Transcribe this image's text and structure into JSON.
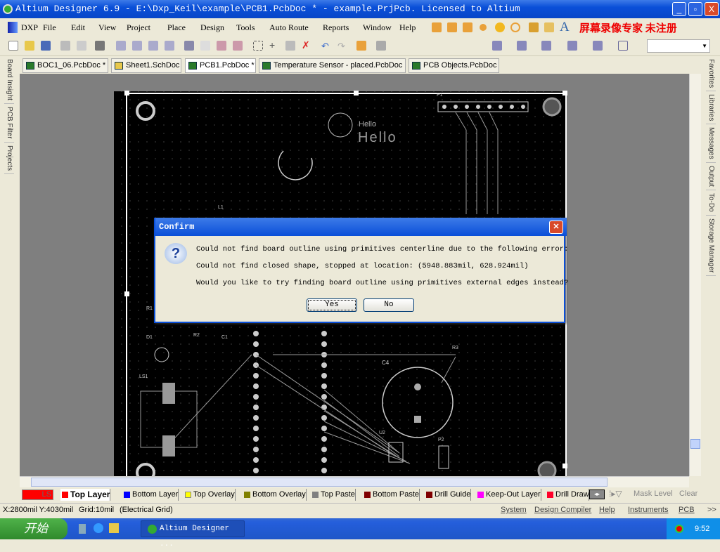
{
  "window": {
    "title": "Altium Designer 6.9 - E:\\Dxp_Keil\\example\\PCB1.PcbDoc * - example.PrjPcb. Licensed to Altium",
    "watermark": "屏幕录像专家 未注册"
  },
  "menu": [
    "DXP",
    "File",
    "Edit",
    "View",
    "Project",
    "Place",
    "Design",
    "Tools",
    "Auto Route",
    "Reports",
    "Window",
    "Help"
  ],
  "doc_tabs": [
    "BOC1_06.PcbDoc *",
    "Sheet1.SchDoc",
    "PCB1.PcbDoc *",
    "Temperature Sensor - placed.PcbDoc",
    "PCB Objects.PcbDoc"
  ],
  "left_panels": [
    "Board Insight",
    "PCB Filter",
    "Projects"
  ],
  "right_panels": [
    "Favorites",
    "Libraries",
    "Messages",
    "Output",
    "To-Do",
    "Storage Manager"
  ],
  "pcb": {
    "labels": [
      "P1",
      "Hello",
      "Hello",
      "L1",
      "R1",
      "R2",
      "C1",
      "C4",
      "R3",
      "U2",
      "P2",
      "LS1",
      "D1"
    ]
  },
  "dialog": {
    "title": "Confirm",
    "icon": "question-icon",
    "line1": "Could not find board outline using primitives centerline due to the following error:",
    "line2": "Could not find closed shape, stopped at location: (5948.883mil, 628.924mil)",
    "line3": "Would you like to try finding board outline using primitives external edges instead?",
    "yes": "Yes",
    "no": "No"
  },
  "layers": {
    "ls": "LS",
    "tabs": [
      {
        "label": "Top Layer",
        "color": "#ff0000"
      },
      {
        "label": "Bottom Layer",
        "color": "#0000ff"
      },
      {
        "label": "Top Overlay",
        "color": "#ffff00"
      },
      {
        "label": "Bottom Overlay",
        "color": "#808000"
      },
      {
        "label": "Top Paste",
        "color": "#808080"
      },
      {
        "label": "Bottom Paste",
        "color": "#800000"
      },
      {
        "label": "Drill Guide",
        "color": "#800000"
      },
      {
        "label": "Keep-Out Layer",
        "color": "#ff00ff"
      },
      {
        "label": "Drill Draw",
        "color": "#ff002a"
      }
    ],
    "mask": "Mask Level",
    "clear": "Clear"
  },
  "status": {
    "coords": "X:2800mil Y:4030mil",
    "grid": "Grid:10mil",
    "mode": "(Electrical Grid)",
    "buttons": [
      "System",
      "Design Compiler",
      "Help",
      "Instruments",
      "PCB"
    ],
    "more": ">>"
  },
  "taskbar": {
    "start": "开始",
    "task": "Altium Designer ...",
    "time": "9:52"
  }
}
